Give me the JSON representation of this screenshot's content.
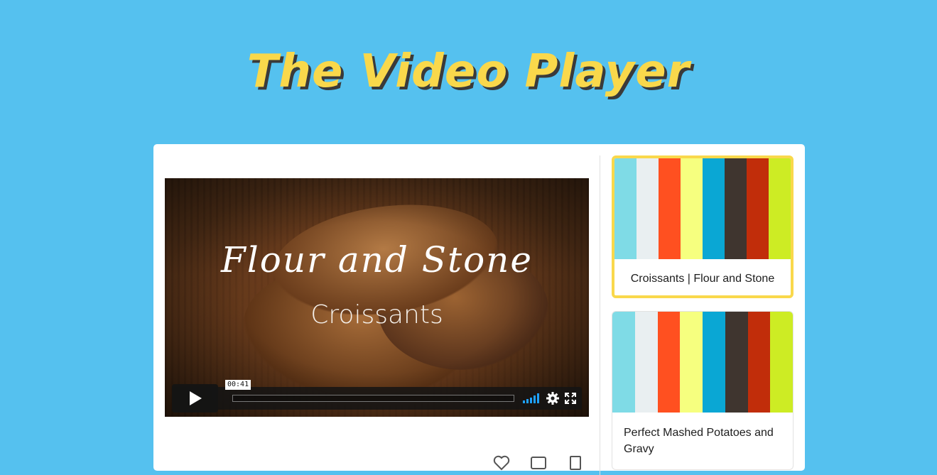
{
  "page": {
    "title": "The Video Player"
  },
  "player": {
    "brand_text": "Flour and Stone",
    "subtitle_text": "Croissants",
    "time_tooltip": "00:41"
  },
  "playlist": {
    "items": [
      {
        "title": "Croissants | Flour and Stone",
        "active": true
      },
      {
        "title": "Perfect Mashed Potatoes and Gravy",
        "active": false
      }
    ],
    "thumbnail_colors": [
      "#7fdbe6",
      "#e9eff1",
      "#ff5020",
      "#f6ff7f",
      "#0aa7d4",
      "#3f352f",
      "#c12d0a",
      "#cdec24"
    ]
  },
  "colors": {
    "background": "#55c1ef",
    "title": "#f9d84b",
    "accent_volume": "#1ea1ff",
    "active_border": "#f9d84b"
  },
  "icons": [
    "play-icon",
    "volume-icon",
    "gear-icon",
    "fullscreen-icon",
    "heart-icon",
    "watch-later-icon",
    "share-icon"
  ]
}
